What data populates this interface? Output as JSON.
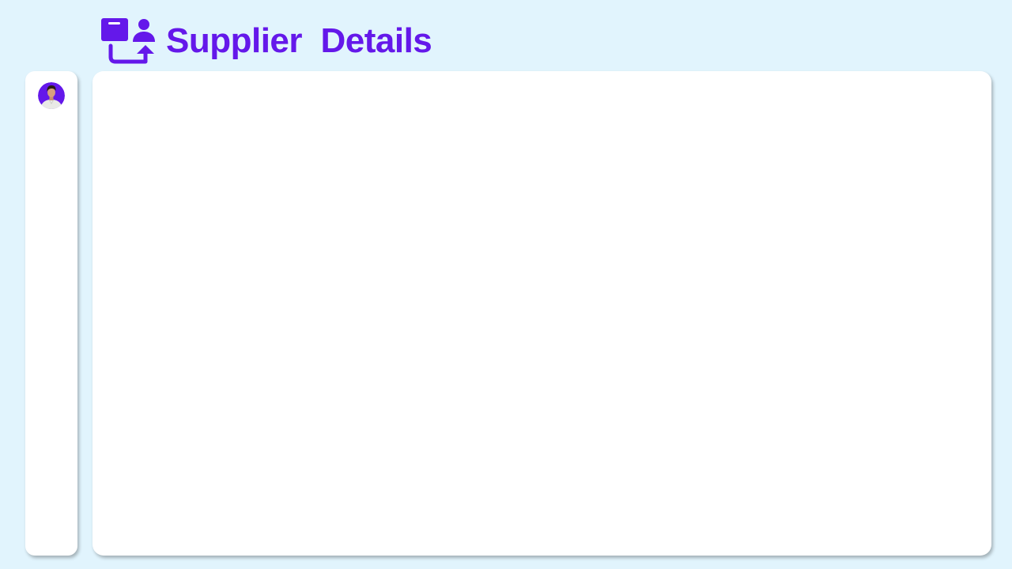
{
  "header": {
    "title": "Supplier  Details",
    "logo_icon": "supplier-handoff-icon"
  },
  "sidebar": {
    "avatar_icon": "user-avatar"
  },
  "colors": {
    "accent": "#6418EA",
    "background": "#E1F4FD",
    "panel": "#FFFFFF"
  }
}
